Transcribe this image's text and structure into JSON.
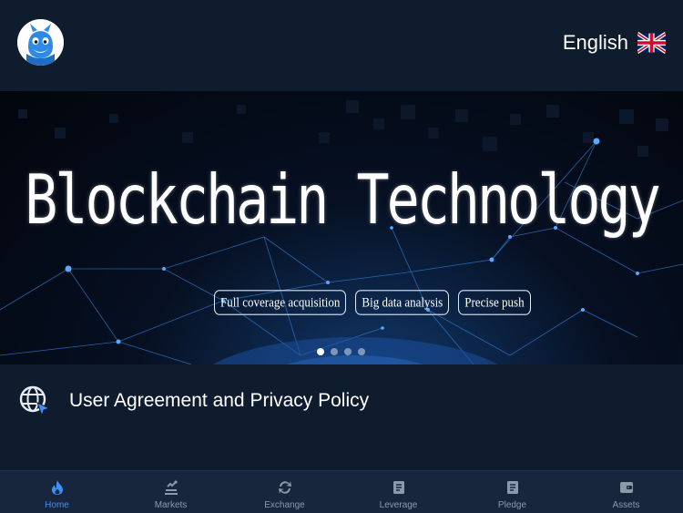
{
  "header": {
    "language_label": "English",
    "language_flag_icon": "uk-flag-icon",
    "logo_icon": "mascot-logo-icon"
  },
  "banner": {
    "title": "Blockchain Technology",
    "tags": [
      "Full coverage acquisition",
      "Big data analysis",
      "Precise push"
    ],
    "slides_count": 4,
    "active_slide": 1
  },
  "agreement": {
    "icon": "globe-cursor-icon",
    "label": "User Agreement and Privacy Policy"
  },
  "tabbar": {
    "tabs": [
      {
        "label": "Home",
        "icon": "flame-icon",
        "active": true
      },
      {
        "label": "Markets",
        "icon": "markets-icon",
        "active": false
      },
      {
        "label": "Exchange",
        "icon": "exchange-icon",
        "active": false
      },
      {
        "label": "Leverage",
        "icon": "leverage-icon",
        "active": false
      },
      {
        "label": "Pledge",
        "icon": "pledge-icon",
        "active": false
      },
      {
        "label": "Assets",
        "icon": "wallet-icon",
        "active": false
      }
    ]
  },
  "colors": {
    "background": "#0f1c2e",
    "tabbar": "#18263d",
    "accent": "#3f8ff7",
    "inactive_tab": "#8c99ad"
  }
}
